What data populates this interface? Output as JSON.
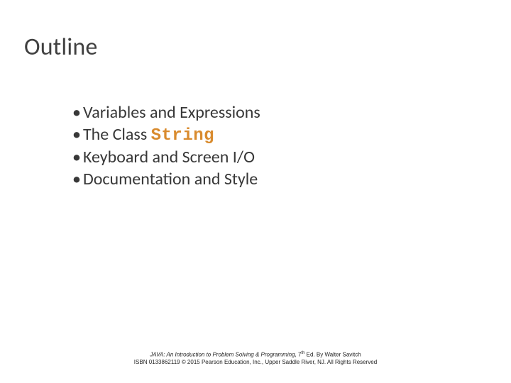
{
  "title": "Outline",
  "bullets": {
    "b0": "Variables and Expressions",
    "b1_pre": "The Class ",
    "b1_code": "String",
    "b2": "Keyboard and Screen I/O",
    "b3": "Documentation and Style"
  },
  "footer": {
    "book": "JAVA: An Introduction to Problem Solving & Programming",
    "ed_pre": ", 7",
    "ed_sup": "th",
    "ed_post": " Ed. By Walter Savitch",
    "line2": "ISBN 0133862119 © 2015 Pearson Education, Inc., Upper Saddle River, NJ. All Rights Reserved"
  }
}
